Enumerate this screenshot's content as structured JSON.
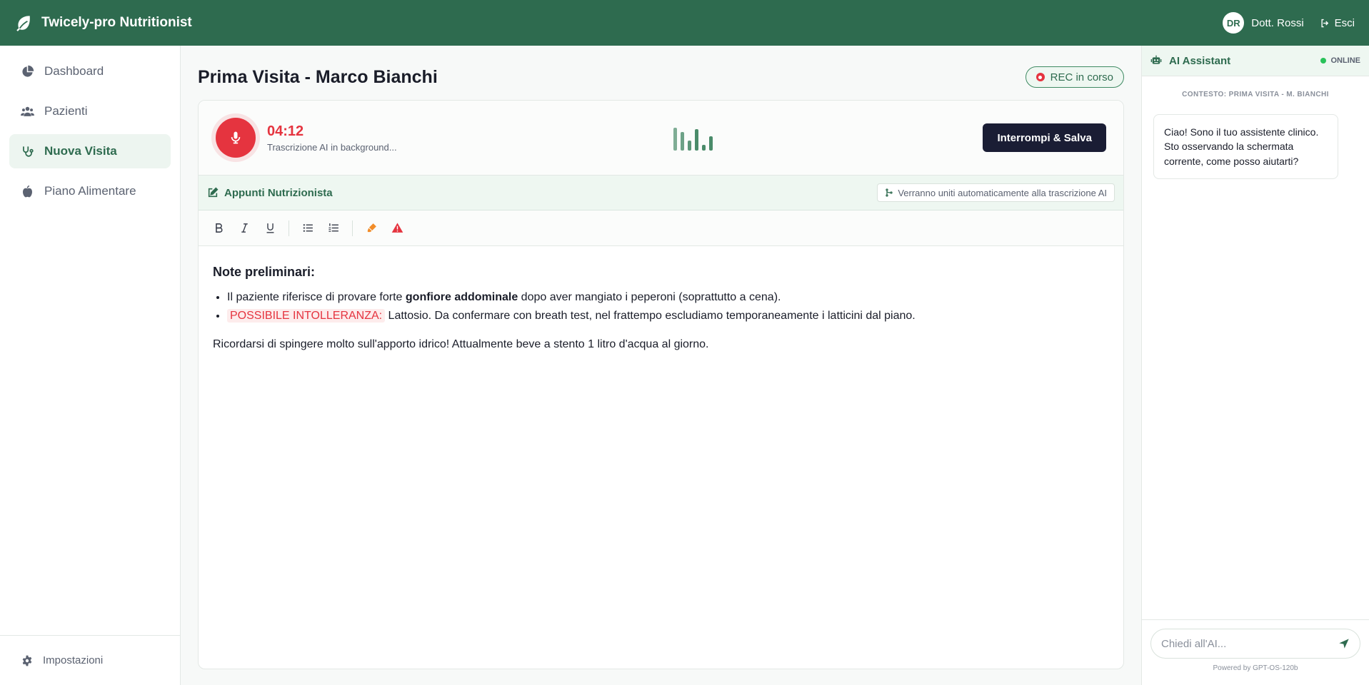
{
  "header": {
    "brand": "Twicely-pro Nutritionist",
    "user_initials": "DR",
    "user_name": "Dott. Rossi",
    "logout": "Esci"
  },
  "sidebar": {
    "items": [
      {
        "label": "Dashboard",
        "icon": "pie-chart-icon"
      },
      {
        "label": "Pazienti",
        "icon": "users-icon"
      },
      {
        "label": "Nuova Visita",
        "icon": "stethoscope-icon",
        "active": true
      },
      {
        "label": "Piano Alimentare",
        "icon": "apple-icon"
      }
    ],
    "settings": "Impostazioni"
  },
  "main": {
    "title": "Prima Visita - Marco Bianchi",
    "rec_badge": "REC in corso",
    "recorder": {
      "time": "04:12",
      "subtitle": "Trascrizione AI in background...",
      "stop_label": "Interrompi & Salva"
    },
    "notes": {
      "title": "Appunti Nutrizionista",
      "merge_info": "Verranno uniti automaticamente alla trascrizione AI"
    },
    "editor": {
      "heading": "Note preliminari:",
      "bullet1_pre": "Il paziente riferisce di provare forte ",
      "bullet1_bold": "gonfiore addominale",
      "bullet1_post": " dopo aver mangiato i peperoni (soprattutto a cena).",
      "bullet2_tag": "POSSIBILE INTOLLERANZA:",
      "bullet2_text": " Lattosio. Da confermare con breath test, nel frattempo escludiamo temporaneamente i latticini dal piano.",
      "paragraph": "Ricordarsi di spingere molto sull'apporto idrico! Attualmente beve a stento 1 litro d'acqua al giorno."
    }
  },
  "ai": {
    "title": "AI Assistant",
    "status": "ONLINE",
    "context": "CONTESTO: PRIMA VISITA - M. BIANCHI",
    "message": "Ciao! Sono il tuo assistente clinico. Sto osservando la schermata corrente, come posso aiutarti?",
    "input_placeholder": "Chiedi all'AI...",
    "powered": "Powered by GPT-OS-120b"
  },
  "colors": {
    "brand_green": "#2e6b4f",
    "record_red": "#e5343f",
    "dark_button": "#1a1d34",
    "online_green": "#29c25a"
  }
}
